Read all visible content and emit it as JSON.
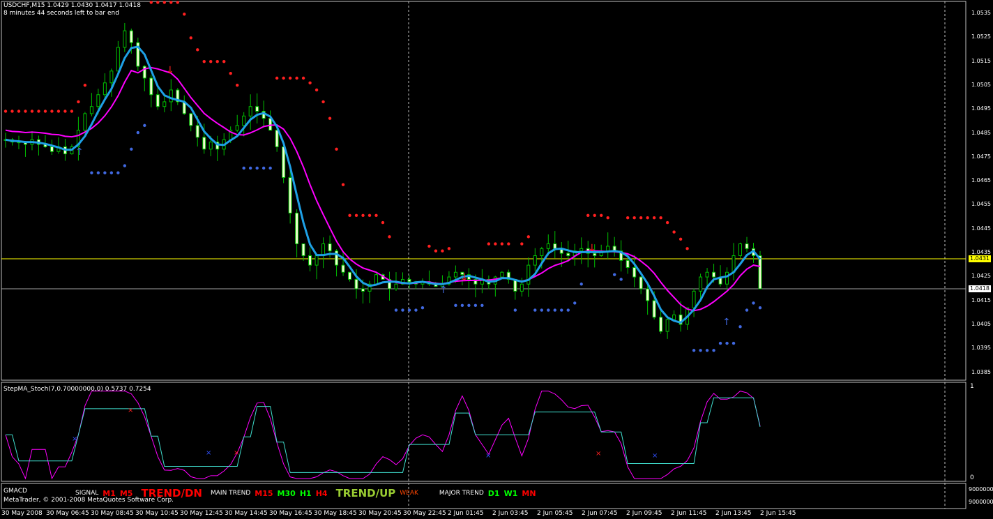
{
  "window": {
    "symbol_line": "USDCHF,M15  1.0429 1.0430 1.0417 1.0418",
    "bar_timer": "8 minutes 44 seconds left to bar end"
  },
  "price_axis": {
    "ticks": [
      "1.0535",
      "1.0525",
      "1.0515",
      "1.0505",
      "1.0495",
      "1.0485",
      "1.0475",
      "1.0465",
      "1.0455",
      "1.0445",
      "1.0435",
      "1.0425",
      "1.0415",
      "1.0405",
      "1.0395",
      "1.0385"
    ],
    "ask_marker": "1.0431",
    "bid_marker": "1.0418",
    "ask_color": "#ffff00",
    "bid_color": "#ffffff"
  },
  "indicator": {
    "title": "StepMA_Stoch(7,0.70000000,0) 0.5737 0.7254",
    "scale_top": "1",
    "scale_bottom": "0"
  },
  "gmacd": {
    "title": "GMACD",
    "scale_top": "9000000",
    "scale_bottom": "9000000",
    "signal_label": "SIGNAL",
    "signal_tfs": [
      {
        "label": "M1",
        "color": "#ff0000"
      },
      {
        "label": "M5",
        "color": "#ff0000"
      }
    ],
    "signal_trend": {
      "label": "TREND/DN",
      "color": "#ff0000"
    },
    "main_label": "MAIN TREND",
    "main_tfs": [
      {
        "label": "M15",
        "color": "#ff0000"
      },
      {
        "label": "M30",
        "color": "#00ff00"
      },
      {
        "label": "H1",
        "color": "#00ff00"
      },
      {
        "label": "H4",
        "color": "#ff0000"
      }
    ],
    "main_trend": {
      "label": "TREND/UP",
      "color": "#9acd32"
    },
    "weak_label": "WEAK",
    "weak_color": "#ff4500",
    "major_label": "MAJOR TREND",
    "major_tfs": [
      {
        "label": "D1",
        "color": "#00ff00"
      },
      {
        "label": "W1",
        "color": "#00ff00"
      },
      {
        "label": "MN",
        "color": "#ff0000"
      }
    ]
  },
  "copyright": "MetaTrader, © 2001-2008 MetaQuotes Software Corp.",
  "time_axis": [
    "30 May 2008",
    "30 May 06:45",
    "30 May 08:45",
    "30 May 10:45",
    "30 May 12:45",
    "30 May 14:45",
    "30 May 16:45",
    "30 May 18:45",
    "30 May 20:45",
    "30 May 22:45",
    "2 Jun 01:45",
    "2 Jun 03:45",
    "2 Jun 05:45",
    "2 Jun 07:45",
    "2 Jun 09:45",
    "2 Jun 11:45",
    "2 Jun 13:45",
    "2 Jun 15:45"
  ],
  "chart_data": {
    "type": "candlestick",
    "symbol": "USDCHF",
    "timeframe": "M15",
    "y_range": [
      1.038,
      1.054
    ],
    "close_series": [
      1.0481,
      1.048,
      1.048,
      1.0479,
      1.0481,
      1.0479,
      1.0478,
      1.0476,
      1.0478,
      1.0475,
      1.0478,
      1.0485,
      1.0492,
      1.0495,
      1.05,
      1.0505,
      1.051,
      1.052,
      1.0527,
      1.0522,
      1.0512,
      1.0507,
      1.05,
      1.0495,
      1.0497,
      1.0502,
      1.0497,
      1.0492,
      1.0487,
      1.0482,
      1.0477,
      1.048,
      1.0477,
      1.0481,
      1.0485,
      1.0487,
      1.0491,
      1.0495,
      1.0493,
      1.049,
      1.0485,
      1.0478,
      1.0465,
      1.045,
      1.0437,
      1.0432,
      1.0428,
      1.0432,
      1.0437,
      1.0434,
      1.0428,
      1.0425,
      1.0422,
      1.0418,
      1.0417,
      1.042,
      1.0424,
      1.0422,
      1.0418,
      1.042,
      1.0422,
      1.0421,
      1.042,
      1.0421,
      1.042,
      1.0419,
      1.042,
      1.0423,
      1.0425,
      1.0424,
      1.0422,
      1.042,
      1.0422,
      1.042,
      1.0423,
      1.0425,
      1.0422,
      1.0417,
      1.042,
      1.0428,
      1.0432,
      1.0435,
      1.0437,
      1.0435,
      1.0433,
      1.0432,
      1.0434,
      1.0435,
      1.0433,
      1.0432,
      1.0434,
      1.0436,
      1.0434,
      1.043,
      1.0427,
      1.0423,
      1.0418,
      1.0413,
      1.0406,
      1.04,
      1.0405,
      1.0407,
      1.0403,
      1.041,
      1.0417,
      1.0423,
      1.0425,
      1.0423,
      1.042,
      1.0425,
      1.0432,
      1.0437,
      1.0435,
      1.0432,
      1.0418
    ],
    "series": [
      {
        "name": "StepMA",
        "color": "#ff00ff"
      },
      {
        "name": "Stoch",
        "color": "#40e0d0"
      }
    ],
    "indicator_range": [
      0,
      1
    ],
    "indicator_values": {
      "StepMA": 0.5737,
      "Stoch": 0.7254
    }
  }
}
